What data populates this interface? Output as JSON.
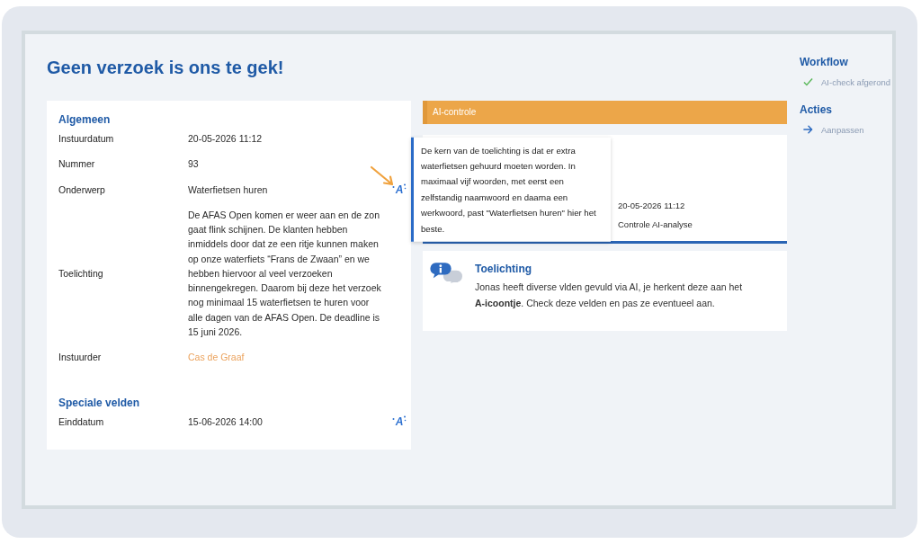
{
  "page": {
    "title": "Geen verzoek is ons te gek!"
  },
  "details": {
    "sections": [
      {
        "heading": "Algemeen",
        "fields": [
          {
            "label": "Instuurdatum",
            "value": "20-05-2026 11:12",
            "kind": "text"
          },
          {
            "label": "Nummer",
            "value": "93",
            "kind": "text"
          },
          {
            "label": "Onderwerp",
            "value": "Waterfietsen huren",
            "kind": "text",
            "ai_icon": "A",
            "callout": true,
            "tooltip": "De kern van de toelichting is dat er extra waterfietsen gehuurd moeten worden. In maximaal vijf woorden, met eerst een zelfstandig naamwoord en daarna een werkwoord, past \"Waterfietsen huren\" hier het beste."
          },
          {
            "label": "Toelichting",
            "value": "De AFAS Open komen er weer aan en de zon gaat flink schijnen. De klanten hebben inmiddels door dat ze een ritje kunnen maken op onze waterfiets “Frans de Zwaan” en we hebben hiervoor al veel verzoeken binnengekregen. Daarom bij deze het verzoek nog minimaal 15 waterfietsen te huren voor alle dagen van de AFAS Open. De deadline is 15 juni 2026.",
            "kind": "text"
          },
          {
            "label": "Instuurder",
            "value": "Cas de Graaf",
            "kind": "link"
          }
        ]
      },
      {
        "heading": "Speciale velden",
        "fields": [
          {
            "label": "Einddatum",
            "value": "15-06-2026 14:00",
            "kind": "text",
            "ai_icon": "A",
            "callout": false
          }
        ]
      }
    ]
  },
  "ai_check": {
    "header": "AI-controle",
    "date": "20-05-2026 11:12",
    "type_label": "Controle AI-analyse"
  },
  "info": {
    "title": "Toelichting",
    "text": "Jonas heeft diverse vlden gevuld via AI, je herkent deze aan het **A-icoontje**. Check deze velden en pas ze eventueel aan."
  },
  "sidebar": {
    "groups": [
      {
        "heading": "Workflow",
        "items": [
          {
            "kind": "status",
            "label": "AI-check afgerond",
            "done": true
          }
        ]
      },
      {
        "heading": "Acties",
        "items": [
          {
            "kind": "action",
            "label": "Aanpassen"
          }
        ]
      }
    ]
  }
}
